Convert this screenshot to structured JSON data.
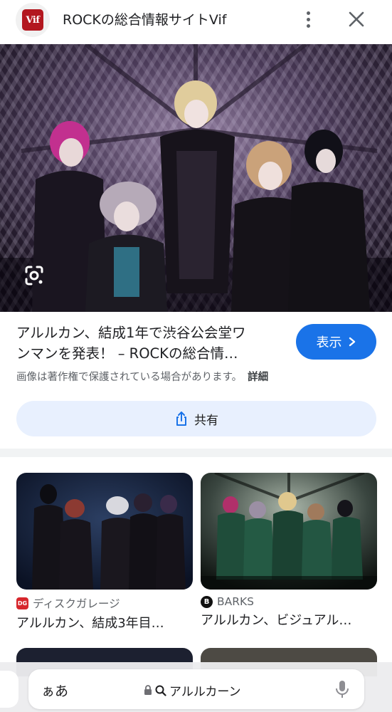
{
  "header": {
    "logo_text": "Vif",
    "site_title": "ROCKの総合情報サイトVif",
    "more_icon": "more-vert-icon",
    "close_icon": "close-icon"
  },
  "hero": {
    "lens_icon": "google-lens-icon"
  },
  "result": {
    "title_line1": "アルルカン、結成1年で渋谷公会堂ワ",
    "title_line2": "ンマンを発表！ – ROCKの総合情…",
    "visit_label": "表示",
    "copyright_notice": "画像は著作権で保護されている場合があります。",
    "details_label": "詳細",
    "share_label": "共有"
  },
  "related": [
    {
      "source_icon": "DG",
      "source": "ディスクガレージ",
      "title": "アルルカン、結成3年目…"
    },
    {
      "source_icon": "B",
      "source": "BARKS",
      "title": "アルルカン、ビジュアル…"
    }
  ],
  "address_bar": {
    "aa_label": "ぁあ",
    "query": "アルルカーン"
  },
  "colors": {
    "accent": "#1a73e8",
    "share_bg": "#e8f0fe",
    "logo_red": "#b3171f"
  }
}
